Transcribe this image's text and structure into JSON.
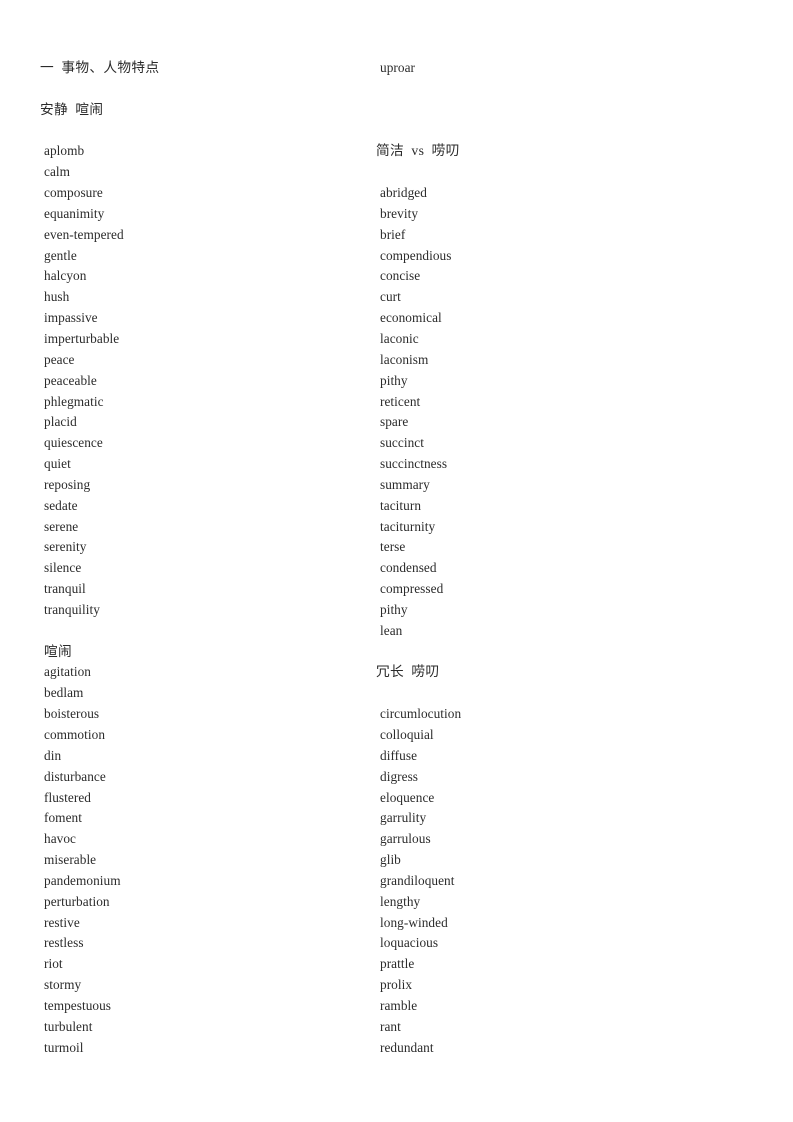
{
  "document": {
    "section_title": "一  事物、人物特点",
    "left_column": {
      "heading_1": "安静  喧闹",
      "list_1": [
        "aplomb",
        "calm",
        "composure",
        "equanimity",
        "even-tempered",
        "gentle",
        "halcyon",
        "hush",
        "impassive",
        "imperturbable",
        "peace",
        "peaceable",
        "phlegmatic",
        "placid",
        "quiescence",
        "quiet",
        "reposing",
        "sedate",
        "serene",
        "serenity",
        "silence",
        "tranquil",
        "tranquility"
      ],
      "heading_2": "喧闹",
      "list_2": [
        "agitation",
        "bedlam",
        "boisterous",
        "commotion",
        "din",
        "disturbance",
        "flustered",
        "foment",
        "havoc",
        "miserable",
        "pandemonium",
        "perturbation",
        "restive",
        "restless",
        "riot",
        "stormy",
        "tempestuous",
        "turbulent",
        "turmoil"
      ]
    },
    "right_column": {
      "continued_word": "uproar",
      "heading_1": "简洁  vs  唠叨",
      "list_1": [
        "abridged",
        "brevity",
        "brief",
        "compendious",
        "concise",
        "curt",
        "economical",
        "laconic",
        "laconism",
        "pithy",
        "reticent",
        "spare",
        "succinct",
        "succinctness",
        "summary",
        "taciturn",
        "taciturnity",
        "terse",
        "condensed",
        "compressed",
        "pithy",
        "lean"
      ],
      "heading_2": "冗长  唠叨",
      "list_2": [
        "circumlocution",
        "colloquial",
        "diffuse",
        "digress",
        "eloquence",
        "garrulity",
        "garrulous",
        "glib",
        "grandiloquent",
        "lengthy",
        "long-winded",
        "loquacious",
        "prattle",
        "prolix",
        "ramble",
        "rant",
        "redundant"
      ]
    }
  },
  "colors": {
    "page_background": "#ffffff",
    "text": "#2b2b2b"
  }
}
